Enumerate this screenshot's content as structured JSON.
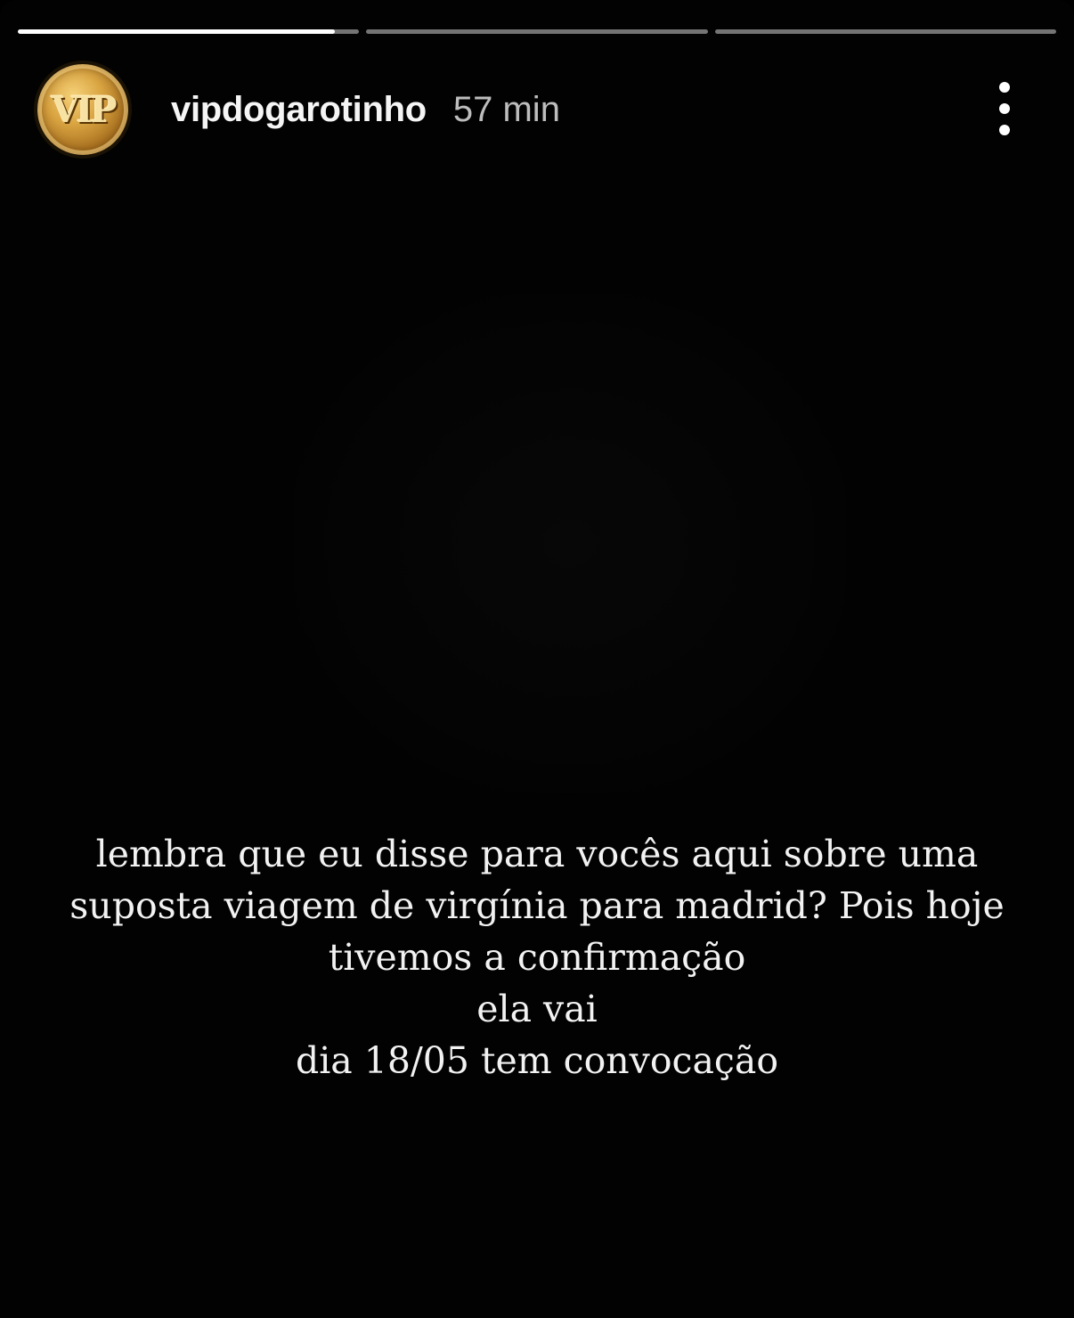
{
  "story": {
    "progress": [
      {
        "fraction": 0.93
      },
      {
        "fraction": 0
      },
      {
        "fraction": 0
      }
    ],
    "header": {
      "avatar_text": "VIP",
      "username": "vipdogarotinho",
      "time": "57 min",
      "more_icon": "more-vertical-icon"
    },
    "caption": {
      "lines": [
        "lembra que eu disse para vocês aqui sobre uma",
        "suposta viagem de virgínia para madrid? Pois hoje",
        "tivemos a confirmação",
        "ela vai",
        "dia 18/05 tem convocação"
      ]
    }
  },
  "colors": {
    "background": "#000000",
    "avatar_gold": "#d9a441",
    "progress_track": "rgba(255,255,255,0.45)",
    "progress_fill": "#ffffff"
  }
}
